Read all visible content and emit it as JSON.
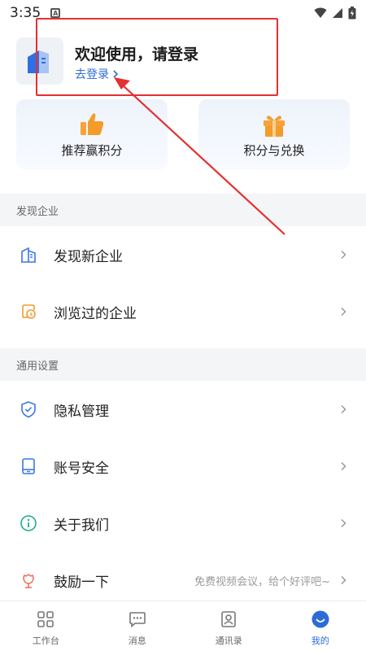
{
  "status_bar": {
    "time": "3:35",
    "notif_glyph": "A"
  },
  "profile": {
    "welcome": "欢迎使用，请登录",
    "login_link": "去登录",
    "avatar_icon": "building-avatar-icon"
  },
  "cards": [
    {
      "label": "推荐赢积分",
      "icon": "thumbs-up-icon"
    },
    {
      "label": "积分与兑换",
      "icon": "gift-icon"
    }
  ],
  "sections": {
    "discover": "发现企业",
    "settings": "通用设置"
  },
  "menu": {
    "discover_new": "发现新企业",
    "browsed": "浏览过的企业",
    "privacy": "隐私管理",
    "account_security": "账号安全",
    "about": "关于我们",
    "encourage": "鼓励一下",
    "encourage_sub": "免费视频会议，给个好评吧~"
  },
  "tabs": [
    {
      "label": "工作台",
      "icon": "grid-icon"
    },
    {
      "label": "消息",
      "icon": "message-icon"
    },
    {
      "label": "通讯录",
      "icon": "contacts-icon"
    },
    {
      "label": "我的",
      "icon": "profile-face-icon"
    }
  ],
  "colors": {
    "accent": "#2d6bd9",
    "highlight_red": "#e53030",
    "orange": "#f39c2a",
    "teal": "#1fae8a",
    "section_bg": "#f4f5f7"
  }
}
